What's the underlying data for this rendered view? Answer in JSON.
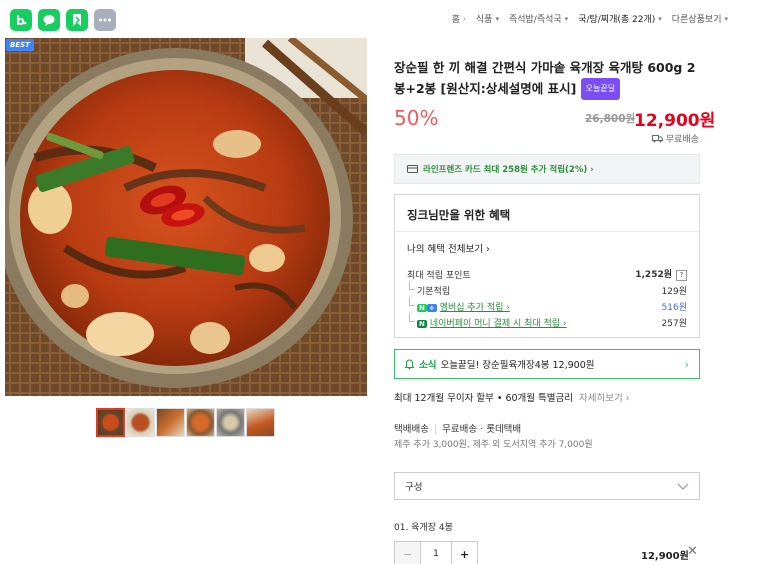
{
  "topbar": {
    "app_icons": [
      {
        "name": "blog-icon",
        "color": "#19ce60"
      },
      {
        "name": "talk-icon",
        "color": "#19ce60"
      },
      {
        "name": "bookmark-icon",
        "color": "#19ce60"
      },
      {
        "name": "more-icon",
        "color": "#a9b0bd"
      }
    ],
    "breadcrumbs": [
      {
        "label": "홈",
        "caret": "›"
      },
      {
        "label": "식품",
        "caret": "▾"
      },
      {
        "label": "즉석밥/즉석국",
        "caret": "▾"
      },
      {
        "label": "국/탕/찌개(총 22개)",
        "caret": "▾"
      },
      {
        "label": "다른상품보기",
        "caret": "▾"
      }
    ]
  },
  "gallery": {
    "badge": "BEST",
    "thumbnail_count": 6,
    "active_thumbnail": 1
  },
  "product": {
    "title": "장순필 한 끼 해결 간편식 가마솥 육개장 육개탕 600g 2봉+2봉 [원산지:상세설명에 표시]",
    "today_badge": "오늘끝딜",
    "discount": "50%",
    "original_price": "26,800원",
    "sale_price": "12,900원",
    "shipping": "무료배송"
  },
  "card_promo": "라인프렌즈 카드 최대 258원 추가 적립(2%) ›",
  "benefits": {
    "title": "징크님만을 위한 혜택",
    "all_link": "나의 혜택 전체보기 ›",
    "max_points_label": "최대 적립 포인트",
    "max_points_value": "1,252원",
    "help": "?",
    "rows": [
      {
        "label": "기본적립",
        "value": "129원"
      },
      {
        "label": "멤버십 추가 적립 ›",
        "value": "516원"
      },
      {
        "label": "네이버페이 머니 결제 시 최대 적립 ›",
        "value": "257원"
      }
    ],
    "n_badge": "N",
    "plus_badge": "+",
    "pay_badge": "N"
  },
  "news": {
    "label": "소식",
    "text": "오늘끝딜! 장순필육개장4봉 12,900원",
    "chevron": "›"
  },
  "installment": {
    "text": "최대 12개월 무이자 할부 • 60개월 특별금리",
    "more": "자세히보기 ›"
  },
  "delivery": {
    "type": "택배배송",
    "fee": "무료배송",
    "carrier": "롯데택배",
    "sep": "|",
    "extra": "제주 추가 3,000원, 제주 외 도서지역 추가 7,000원"
  },
  "option_select": {
    "placeholder": "구성"
  },
  "selected_option": {
    "name": "01. 육개장 4봉",
    "minus": "−",
    "quantity": "1",
    "plus": "+",
    "price": "12,900원",
    "remove": "✕"
  }
}
